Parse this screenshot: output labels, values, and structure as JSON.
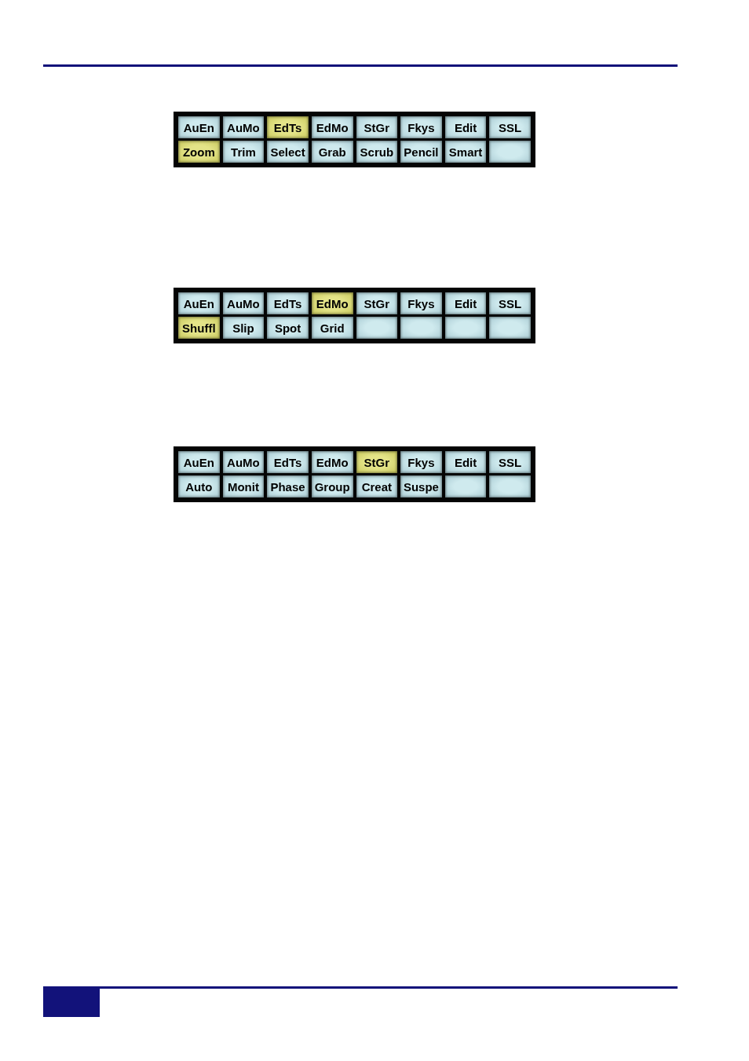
{
  "panels": [
    {
      "tabs": [
        {
          "label": "AuEn",
          "selected": false
        },
        {
          "label": "AuMo",
          "selected": false
        },
        {
          "label": "EdTs",
          "selected": true
        },
        {
          "label": "EdMo",
          "selected": false
        },
        {
          "label": "StGr",
          "selected": false
        },
        {
          "label": "Fkys",
          "selected": false
        },
        {
          "label": "Edit",
          "selected": false
        },
        {
          "label": "SSL",
          "selected": false
        }
      ],
      "buttons": [
        {
          "label": "Zoom",
          "selected": true
        },
        {
          "label": "Trim",
          "selected": false
        },
        {
          "label": "Select",
          "selected": false
        },
        {
          "label": "Grab",
          "selected": false
        },
        {
          "label": "Scrub",
          "selected": false
        },
        {
          "label": "Pencil",
          "selected": false
        },
        {
          "label": "Smart",
          "selected": false
        },
        {
          "selected": false
        }
      ]
    },
    {
      "tabs": [
        {
          "label": "AuEn",
          "selected": false
        },
        {
          "label": "AuMo",
          "selected": false
        },
        {
          "label": "EdTs",
          "selected": false
        },
        {
          "label": "EdMo",
          "selected": true
        },
        {
          "label": "StGr",
          "selected": false
        },
        {
          "label": "Fkys",
          "selected": false
        },
        {
          "label": "Edit",
          "selected": false
        },
        {
          "label": "SSL",
          "selected": false
        }
      ],
      "buttons": [
        {
          "label": "Shuffl",
          "selected": true
        },
        {
          "label": "Slip",
          "selected": false
        },
        {
          "label": "Spot",
          "selected": false
        },
        {
          "label": "Grid",
          "selected": false
        },
        {
          "selected": false
        },
        {
          "selected": false
        },
        {
          "selected": false
        },
        {
          "selected": false
        }
      ]
    },
    {
      "tabs": [
        {
          "label": "AuEn",
          "selected": false
        },
        {
          "label": "AuMo",
          "selected": false
        },
        {
          "label": "EdTs",
          "selected": false
        },
        {
          "label": "EdMo",
          "selected": false
        },
        {
          "label": "StGr",
          "selected": true
        },
        {
          "label": "Fkys",
          "selected": false
        },
        {
          "label": "Edit",
          "selected": false
        },
        {
          "label": "SSL",
          "selected": false
        }
      ],
      "buttons": [
        {
          "label": "Auto",
          "selected": false
        },
        {
          "label": "Monit",
          "selected": false
        },
        {
          "label": "Phase",
          "selected": false
        },
        {
          "label": "Group",
          "selected": false
        },
        {
          "label": "Creat",
          "selected": false
        },
        {
          "label": "Suspe",
          "selected": false
        },
        {
          "selected": false
        },
        {
          "selected": false
        }
      ]
    }
  ]
}
